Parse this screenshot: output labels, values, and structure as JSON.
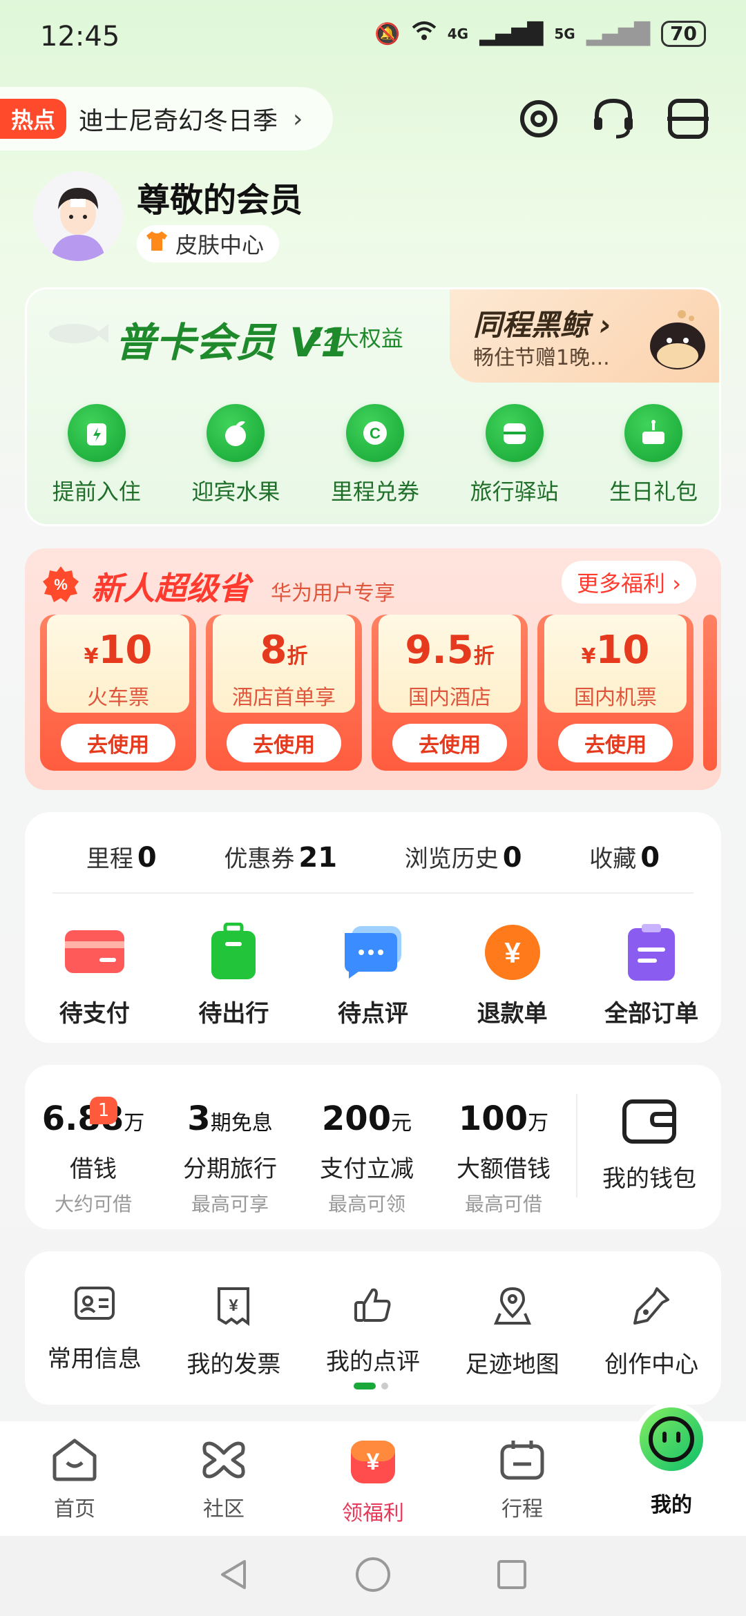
{
  "status_bar": {
    "time": "12:45",
    "network_1": "4G",
    "network_2": "5G",
    "battery": "70"
  },
  "hot": {
    "tag": "热点",
    "text": "迪士尼奇幻冬日季",
    "arrow": "›"
  },
  "profile": {
    "name": "尊敬的会员",
    "skin_label": "皮肤中心"
  },
  "membership": {
    "title": "普卡会员 V1",
    "benefits": "22大权益",
    "whale_title": "同程黑鲸 ›",
    "whale_subtitle": "畅住节赠1晚...",
    "perks": [
      {
        "label": "提前入住",
        "icon": "luggage-icon"
      },
      {
        "label": "迎宾水果",
        "icon": "fruit-icon"
      },
      {
        "label": "里程兑券",
        "icon": "coupon-c-icon"
      },
      {
        "label": "旅行驿站",
        "icon": "station-icon"
      },
      {
        "label": "生日礼包",
        "icon": "cake-icon"
      }
    ]
  },
  "newuser": {
    "title": "新人超级省",
    "subtitle": "华为用户专享",
    "more": "更多福利 ›",
    "coupons": [
      {
        "prefix": "¥",
        "value": "10",
        "suffix": "",
        "name": "火车票",
        "button": "去使用"
      },
      {
        "prefix": "",
        "value": "8",
        "suffix": "折",
        "name": "酒店首单享",
        "button": "去使用"
      },
      {
        "prefix": "",
        "value": "9.5",
        "suffix": "折",
        "name": "国内酒店",
        "button": "去使用"
      },
      {
        "prefix": "¥",
        "value": "10",
        "suffix": "",
        "name": "国内机票",
        "button": "去使用"
      }
    ]
  },
  "stats": [
    {
      "label": "里程",
      "value": "0"
    },
    {
      "label": "优惠券",
      "value": "21"
    },
    {
      "label": "浏览历史",
      "value": "0"
    },
    {
      "label": "收藏",
      "value": "0"
    }
  ],
  "orders": [
    {
      "label": "待支付",
      "icon": "card-icon",
      "color": "#ff5a5a"
    },
    {
      "label": "待出行",
      "icon": "suitcase-icon",
      "color": "#22c43a"
    },
    {
      "label": "待点评",
      "icon": "chat-bubble-icon",
      "color": "#3a8cff"
    },
    {
      "label": "退款单",
      "icon": "yen-coin-icon",
      "color": "#ff7a1a"
    },
    {
      "label": "全部订单",
      "icon": "clipboard-icon",
      "color": "#8a5cf0"
    }
  ],
  "finance": {
    "badge": "1",
    "items": [
      {
        "value": "6.88",
        "unit": "万",
        "label": "借钱",
        "sub": "大约可借"
      },
      {
        "value": "3",
        "unit": "期免息",
        "label": "分期旅行",
        "sub": "最高可享"
      },
      {
        "value": "200",
        "unit": "元",
        "label": "支付立减",
        "sub": "最高可领"
      },
      {
        "value": "100",
        "unit": "万",
        "label": "大额借钱",
        "sub": "最高可借"
      }
    ],
    "wallet": "我的钱包"
  },
  "tools": [
    {
      "label": "常用信息",
      "icon": "id-card-icon"
    },
    {
      "label": "我的发票",
      "icon": "invoice-icon"
    },
    {
      "label": "我的点评",
      "icon": "thumbs-up-icon"
    },
    {
      "label": "足迹地图",
      "icon": "map-pin-icon"
    },
    {
      "label": "创作中心",
      "icon": "pen-icon"
    }
  ],
  "tabs": [
    {
      "label": "首页",
      "icon": "home-icon"
    },
    {
      "label": "社区",
      "icon": "community-icon"
    },
    {
      "label": "领福利",
      "icon": "gift-yen-icon"
    },
    {
      "label": "行程",
      "icon": "trip-icon"
    },
    {
      "label": "我的",
      "icon": "smiley-icon"
    }
  ],
  "colors": {
    "brand_green": "#1f8a2c",
    "promo_red": "#ff3b2f",
    "active_tab": "#e63a5a"
  }
}
